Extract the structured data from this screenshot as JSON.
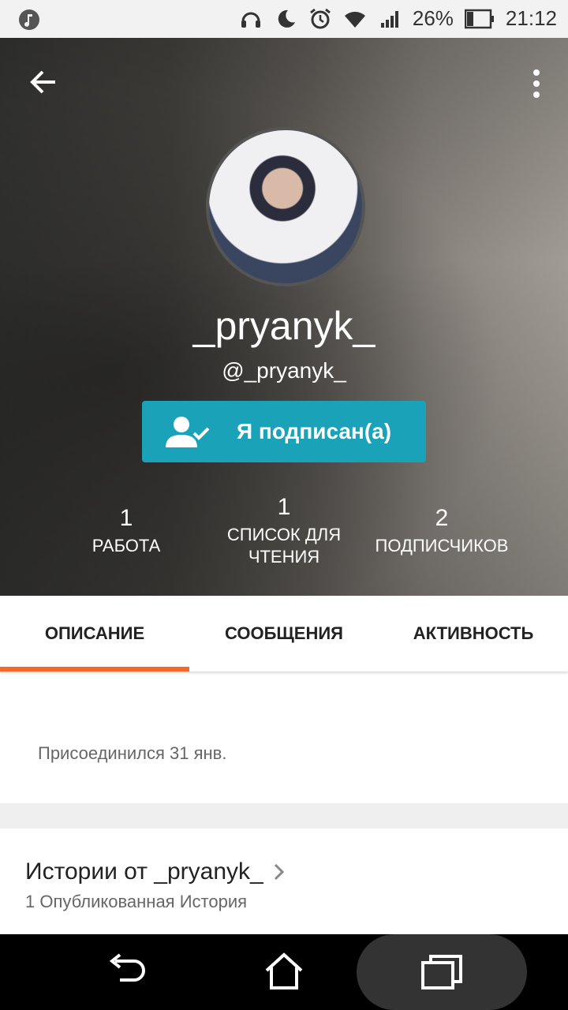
{
  "status_bar": {
    "battery": "26%",
    "time": "21:12"
  },
  "profile": {
    "display_name": "_pryanyk_",
    "handle": "@_pryanyk_",
    "follow_label": "Я подписан(а)"
  },
  "stats": [
    {
      "value": "1",
      "label": "РАБОТА"
    },
    {
      "value": "1",
      "label": "СПИСОК ДЛЯ ЧТЕНИЯ"
    },
    {
      "value": "2",
      "label": "ПОДПИСЧИКОВ"
    }
  ],
  "tabs": [
    {
      "label": "ОПИСАНИЕ",
      "active": true
    },
    {
      "label": "СООБЩЕНИЯ",
      "active": false
    },
    {
      "label": "АКТИВНОСТЬ",
      "active": false
    }
  ],
  "about": {
    "joined": "Присоединился 31 янв."
  },
  "stories": {
    "title": "Истории от _pryanyk_",
    "subtitle": "1 Опубликованная История"
  },
  "colors": {
    "accent": "#1aa3b8",
    "tab_indicator": "#f5682b"
  }
}
